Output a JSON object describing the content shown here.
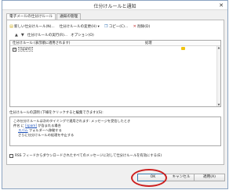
{
  "window": {
    "title": "仕分けルールと通知",
    "close_glyph": "✕"
  },
  "tabs": [
    {
      "label": "電子メールの仕分けルール",
      "active": true
    },
    {
      "label": "通知の管理",
      "active": false
    }
  ],
  "toolbar": {
    "new_rule": "新しい仕分けルール(N)...",
    "change_rule": "仕分けルールの変更(H) ▾",
    "copy": "コピー(C)...",
    "delete": "削除(D)",
    "run_rules": "仕分けルールの実行(R)...",
    "options": "オプション(O)"
  },
  "rules_list": {
    "col_rule": "仕分けルール (表示順に適用されます)",
    "col_action": "処理",
    "rows": [
      {
        "name": "[spam]",
        "checked": true
      }
    ]
  },
  "description": {
    "label": "仕分けルールの説明 (下線をクリックすると編集できます)(S):",
    "lines": [
      {
        "text": "この仕分けルールは次のタイミングで適用されます: メッセージを受信したとき",
        "indent": false,
        "link": ""
      },
      {
        "text": "件名 に ",
        "indent": false,
        "link": "[spam]",
        "suffix": " が含まれる場合"
      },
      {
        "text": "",
        "indent": true,
        "link": "スパム",
        "suffix": " フォルダーへ移動する"
      },
      {
        "text": "さらに仕分けルールの処理を中止する",
        "indent": true,
        "link": ""
      }
    ]
  },
  "rss_option": {
    "label": "RSS フィードからダウンロードされたすべてのメッセージに対して仕分けルールを有効にする(E)",
    "checked": false
  },
  "buttons": {
    "ok": "OK",
    "cancel": "キャンセル",
    "apply": "適用(A)"
  },
  "colors": {
    "highlight_ring": "#cc1f1f",
    "link": "#1a4fb8"
  }
}
